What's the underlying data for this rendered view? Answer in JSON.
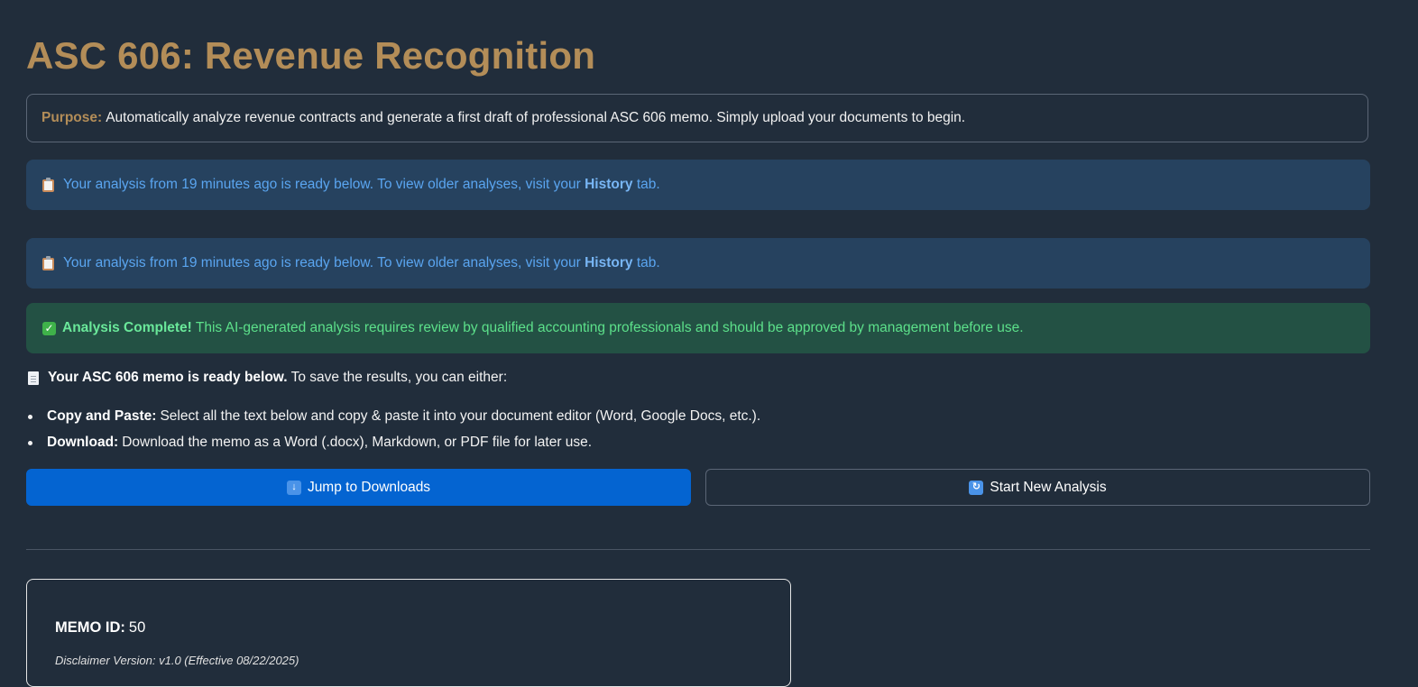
{
  "page": {
    "title": "ASC 606: Revenue Recognition"
  },
  "purpose": {
    "label": "Purpose:",
    "text": "Automatically analyze revenue contracts and generate a first draft of professional ASC 606 memo. Simply upload your documents to begin."
  },
  "alerts": [
    {
      "icon": "clipboard-icon",
      "prefix": "Your analysis from 19 minutes ago is ready below. To view older analyses, visit your ",
      "link": "History",
      "suffix": " tab."
    },
    {
      "icon": "clipboard-icon",
      "prefix": "Your analysis from 19 minutes ago is ready below. To view older analyses, visit your ",
      "link": "History",
      "suffix": " tab."
    }
  ],
  "success": {
    "icon": "check-icon",
    "bold": "Analysis Complete!",
    "text": " This AI-generated analysis requires review by qualified accounting professionals and should be approved by management before use."
  },
  "memo_ready": {
    "icon": "document-icon",
    "bold": "Your ASC 606 memo is ready below.",
    "text": "To save the results, you can either:"
  },
  "save_options": [
    {
      "bold": "Copy and Paste:",
      "text": "Select all the text below and copy & paste it into your document editor (Word, Google Docs, etc.)."
    },
    {
      "bold": "Download:",
      "text": "Download the memo as a Word (.docx), Markdown, or PDF file for later use."
    }
  ],
  "buttons": {
    "jump_label": "Jump to Downloads",
    "jump_icon": "down-arrow-icon",
    "new_label": "Start New Analysis",
    "new_icon": "refresh-icon"
  },
  "memo": {
    "id_label": "MEMO ID:",
    "id_value": "50",
    "disclaimer": "Disclaimer Version: v1.0 (Effective 08/22/2025)"
  },
  "colors": {
    "background": "#212d3b",
    "title": "#b38d58",
    "info_bg": "#26425f",
    "info_text": "#5aa5f0",
    "success_bg": "#235144",
    "success_text": "#5ce08a",
    "primary_button": "#0464d1"
  }
}
